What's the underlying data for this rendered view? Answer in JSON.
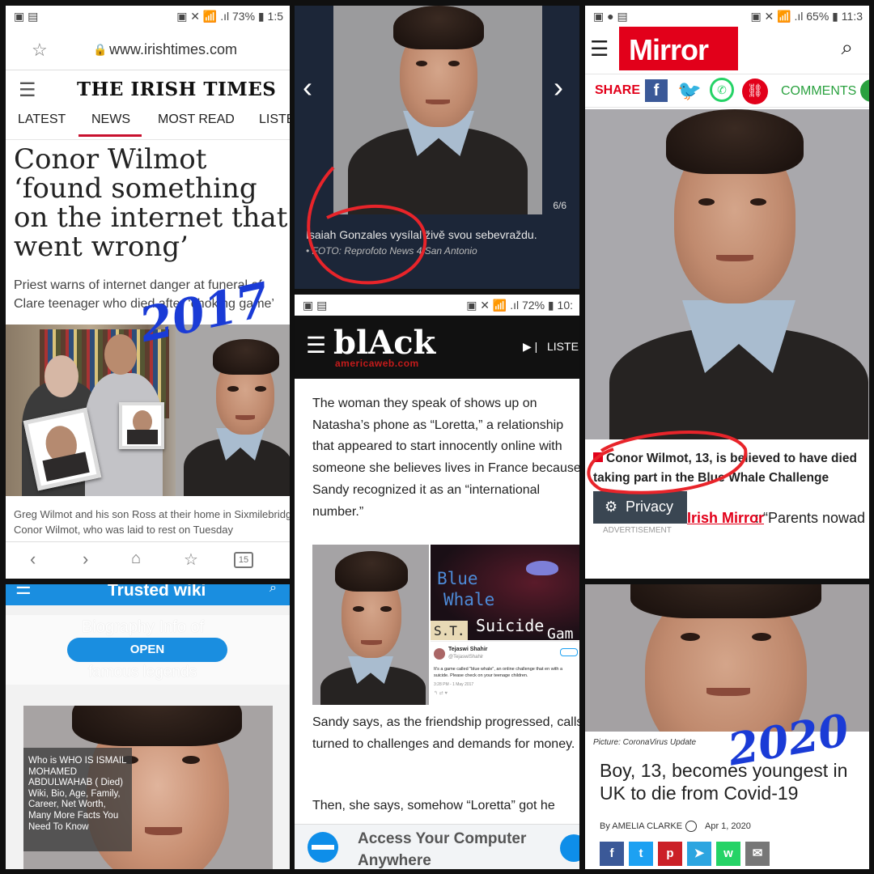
{
  "irish": {
    "status_left": "▣ ▤",
    "status_right": "▣ ✕ 📶 .ıl 73% ▮ 1:5",
    "url": "www.irishtimes.com",
    "logo": "THE IRISH TIMES",
    "tabs": [
      "LATEST",
      "NEWS",
      "MOST READ",
      "LISTE"
    ],
    "headline": "Conor Wilmot ‘found something on the internet that went wrong’",
    "standfirst_1": "Priest warns of internet danger at funeral of",
    "standfirst_2": "Clare teenager who died after ‘choking game’",
    "caption_1": "Greg Wilmot and his son Ross at their home in Sixmilebridge",
    "caption_2": "Conor Wilmot, who was laid to rest on Tuesday",
    "tab_count": "15",
    "handwriting": "2017"
  },
  "czech": {
    "counter": "6/6",
    "caption": "Isaiah Gonzales vysílal živě svou sebevraždu.",
    "credit": "• FOTO: Reprofoto News 4 San Antonio"
  },
  "mirror": {
    "status_right": "▣ ✕ 📶 .ıl 65% ▮ 11:3",
    "logo": "Mirror",
    "share_label": "SHARE",
    "comments_label": "COMMENTS",
    "caption": "Conor Wilmot, 13, is believed to have died taking part in the Blue Whale Challenge",
    "privacy_label": "Privacy",
    "source_link": "Irish Mirror",
    "source_text": ": “Parents nowad",
    "ad_label": "ADVERTISEMENT"
  },
  "black": {
    "status_right": "▣ ✕ 📶 .ıl 72% ▮ 10:",
    "logo": "blAck",
    "logo_sub": "americaweb.com",
    "listen_label": "LISTE",
    "para1": "The woman they speak of shows up on Natasha’s phone as “Loretta,” a relationship that appeared to start innocently online with someone she believes lives in France because Sandy recognized it as an “international number.”",
    "blue_whale_1": "Blue",
    "blue_whale_2": "Whale",
    "st_label": "S.T.",
    "suicide_label": "Suicide",
    "game_label": "Gam",
    "tweet_name": "Tejaswi Shahir",
    "tweet_handle": "@TejaswiShahir",
    "tweet_text": "It's a game called \"blue whale\", an online challenge that en with a suicide. Please check on your teenage children.",
    "tweet_time": "3:28 PM - 1 May 2017",
    "para2": "Sandy says, as the friendship progressed, calls turned to challenges and demands for money.",
    "para3": "Then, she says, somehow “Loretta” got he",
    "ad_title_1": "Access Your Computer",
    "ad_title_2": "Anywhere"
  },
  "wiki": {
    "header_title": "Trusted wiki",
    "ghost_1": "Biography Info of",
    "open_button": "OPEN",
    "ghost_2": "famous legends",
    "overlay_text": "Who is WHO IS ISMAIL MOHAMED ABDULWAHAB ( Died) Wiki, Bio, Age, Family, Career, Net Worth, Many More Facts You Need To Know"
  },
  "covid": {
    "picture_credit": "Picture: CoronaVirus Update",
    "headline": "Boy, 13, becomes youngest in UK to die from Covid-19",
    "byline": "By AMELIA CLARKE",
    "date": "Apr 1, 2020",
    "handwriting": "2020",
    "share_colors": [
      "#3b5998",
      "#1da1f2",
      "#cb2027",
      "#2ca5e0",
      "#25d366",
      "#777777"
    ],
    "share_icons": [
      "f",
      "t",
      "p",
      "➤",
      "w",
      "✉"
    ]
  }
}
